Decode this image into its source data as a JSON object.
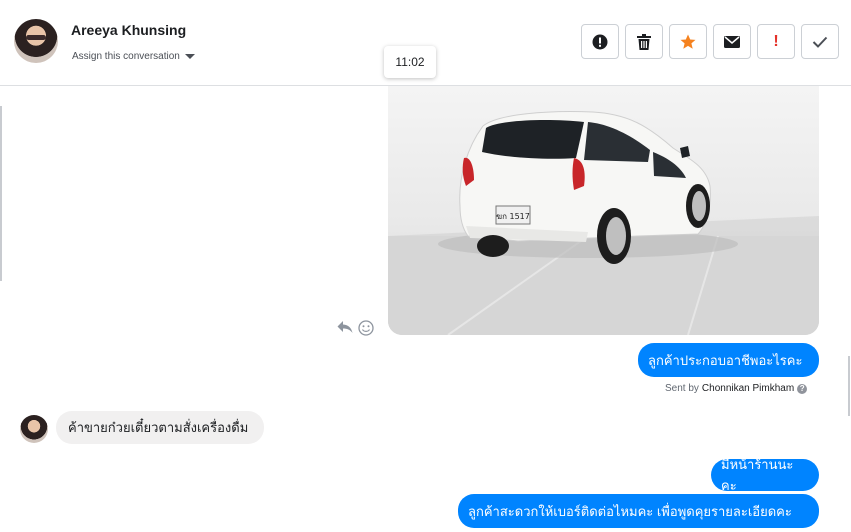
{
  "header": {
    "contact_name": "Areeya Khunsing",
    "assign_label": "Assign this conversation",
    "actions": [
      {
        "name": "mark-spam-button",
        "icon": "exclamation-circle-icon"
      },
      {
        "name": "delete-button",
        "icon": "trash-icon"
      },
      {
        "name": "star-button",
        "icon": "star-icon",
        "color": "#f5821f"
      },
      {
        "name": "email-button",
        "icon": "envelope-icon"
      },
      {
        "name": "flag-important-button",
        "icon": "exclamation-icon",
        "color": "#e4322a"
      },
      {
        "name": "mark-done-button",
        "icon": "check-icon"
      }
    ]
  },
  "tooltip": {
    "time": "11:02"
  },
  "messages": {
    "photo": {
      "icon": "car-photo",
      "plate": "ฆก 1517"
    },
    "out_1": "ลูกค้าประกอบอาชีพอะไรคะ",
    "sent_by_prefix": "Sent by",
    "sent_by_name": "Chonnikan Pimkham",
    "in_1": "ค้าขายก๋วยเตี๋ยวตามสั่งเครื่องดื่ม",
    "out_2": "มีหน้าร้านนะคะ",
    "out_3": "ลูกค้าสะดวกให้เบอร์ติดต่อไหมคะ เพื่อพูดคุยรายละเอียดคะ"
  },
  "colors": {
    "accent": "#0084ff",
    "incoming_bubble": "#f1f0f0"
  }
}
